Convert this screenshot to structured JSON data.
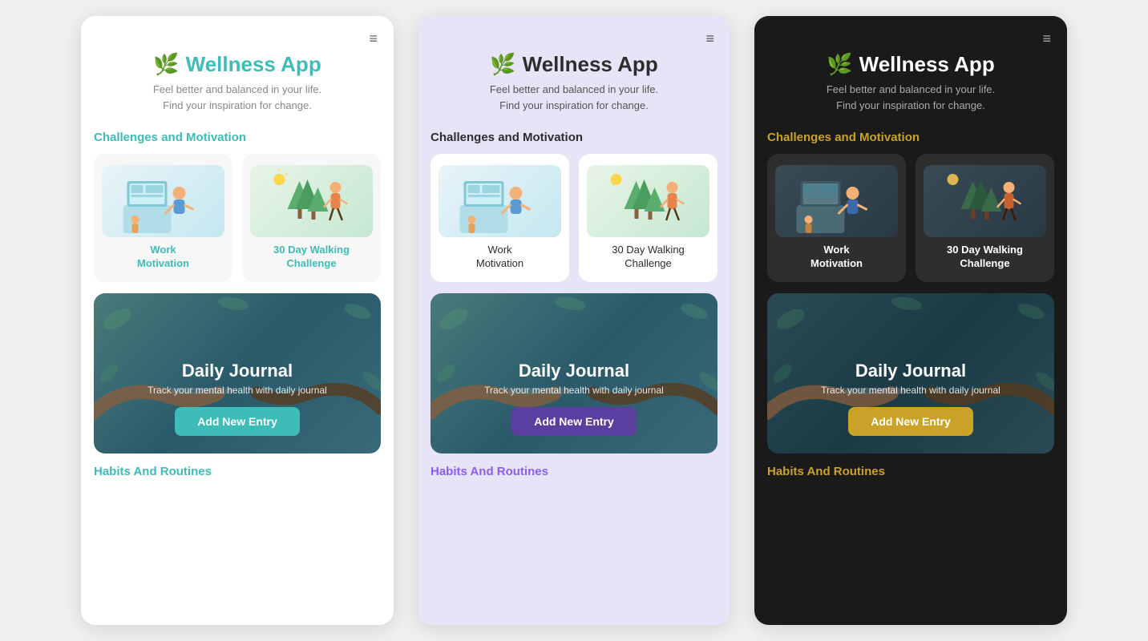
{
  "themes": [
    "light",
    "purple",
    "dark"
  ],
  "screens": [
    {
      "theme": "light",
      "header": {
        "hamburger": "≡",
        "logo": "🌿",
        "title": "Wellness App",
        "tagline": "Feel better and balanced in your life.\nFind your inspiration for change."
      },
      "challengesTitle": "Challenges and Motivation",
      "cards": [
        {
          "label": "Work\nMotivation",
          "illus": "work"
        },
        {
          "label": "30 Day Walking\nChallenge",
          "illus": "walking"
        }
      ],
      "journal": {
        "title": "Daily Journal",
        "subtitle": "Track your mental health with daily journal",
        "btnLabel": "Add New Entry"
      },
      "habitsTitle": "Habits And Routines"
    },
    {
      "theme": "purple",
      "header": {
        "hamburger": "≡",
        "logo": "🌿",
        "title": "Wellness App",
        "tagline": "Feel better and balanced in your life.\nFind your inspiration for change."
      },
      "challengesTitle": "Challenges and Motivation",
      "cards": [
        {
          "label": "Work\nMotivation",
          "illus": "work"
        },
        {
          "label": "30 Day Walking\nChallenge",
          "illus": "walking"
        }
      ],
      "journal": {
        "title": "Daily Journal",
        "subtitle": "Track your mental health with daily journal",
        "btnLabel": "Add New Entry"
      },
      "habitsTitle": "Habits And Routines"
    },
    {
      "theme": "dark",
      "header": {
        "hamburger": "≡",
        "logo": "🌿",
        "title": "Wellness App",
        "tagline": "Feel better and balanced in your life.\nFind your inspiration for change."
      },
      "challengesTitle": "Challenges and Motivation",
      "cards": [
        {
          "label": "Work\nMotivation",
          "illus": "work"
        },
        {
          "label": "30 Day Walking\nChallenge",
          "illus": "walking"
        }
      ],
      "journal": {
        "title": "Daily Journal",
        "subtitle": "Track your mental health with daily journal",
        "btnLabel": "Add New Entry"
      },
      "habitsTitle": "Habits And Routines"
    }
  ]
}
